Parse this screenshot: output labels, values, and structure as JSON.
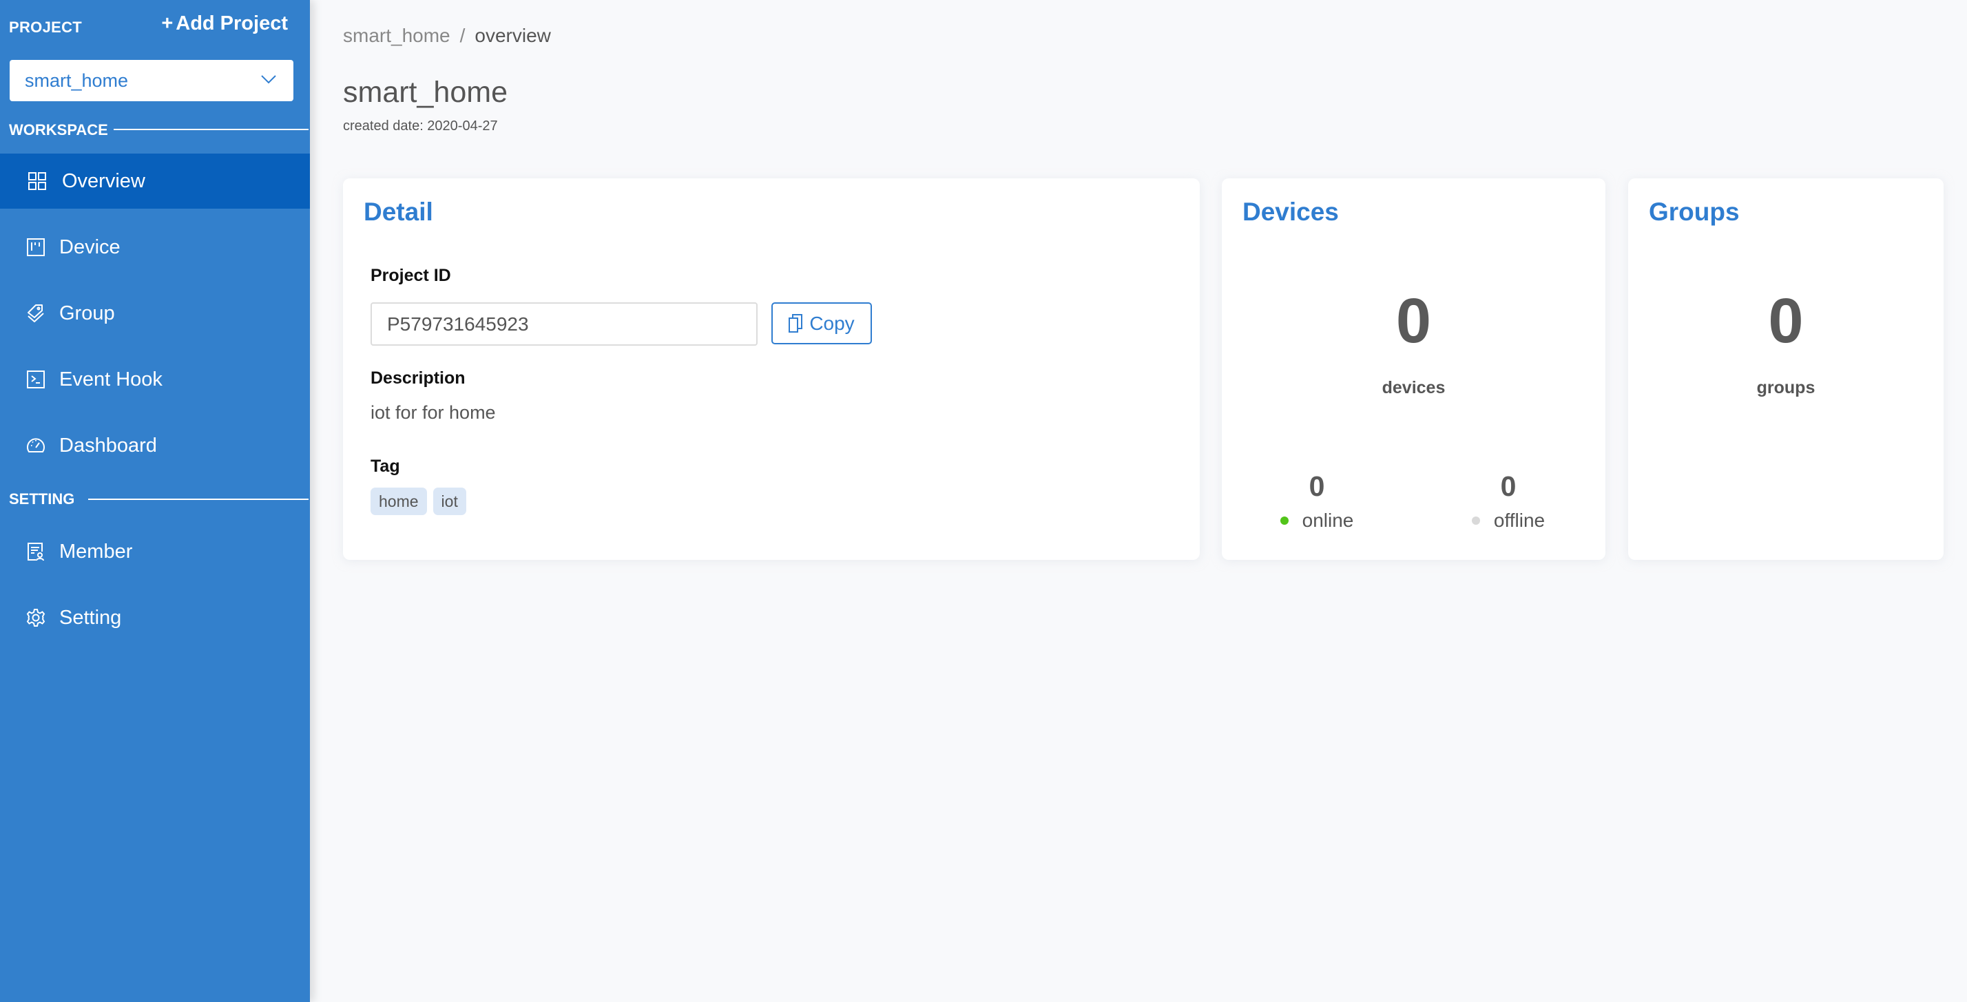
{
  "sidebar": {
    "project_label": "PROJECT",
    "add_project_label": "Add Project",
    "selected_project": "smart_home",
    "workspace_label": "WORKSPACE",
    "setting_label": "SETTING",
    "workspace_items": [
      {
        "label": "Overview",
        "icon": "grid-icon",
        "active": true
      },
      {
        "label": "Device",
        "icon": "device-board-icon",
        "active": false
      },
      {
        "label": "Group",
        "icon": "tags-icon",
        "active": false
      },
      {
        "label": "Event Hook",
        "icon": "terminal-icon",
        "active": false
      },
      {
        "label": "Dashboard",
        "icon": "dashboard-gauge-icon",
        "active": false
      }
    ],
    "setting_items": [
      {
        "label": "Member",
        "icon": "member-certificate-icon",
        "active": false
      },
      {
        "label": "Setting",
        "icon": "gear-icon",
        "active": false
      }
    ]
  },
  "breadcrumb": {
    "parent": "smart_home",
    "separator": "/",
    "current": "overview"
  },
  "header": {
    "title": "smart_home",
    "created_date": "created date: 2020-04-27"
  },
  "detail": {
    "title": "Detail",
    "project_id_label": "Project ID",
    "project_id_value": "P579731645923",
    "copy_label": "Copy",
    "description_label": "Description",
    "description_value": "iot for for home",
    "tag_label": "Tag",
    "tags": [
      "home",
      "iot"
    ]
  },
  "devices": {
    "title": "Devices",
    "total": "0",
    "total_label": "devices",
    "online_count": "0",
    "online_label": "online",
    "offline_count": "0",
    "offline_label": "offline",
    "online_color": "#52c41a",
    "offline_color": "#d9d9d9"
  },
  "groups": {
    "title": "Groups",
    "total": "0",
    "total_label": "groups"
  },
  "colors": {
    "sidebar_bg": "#3380cc",
    "sidebar_active_bg": "#0860bb",
    "accent": "#2f7dd0"
  }
}
